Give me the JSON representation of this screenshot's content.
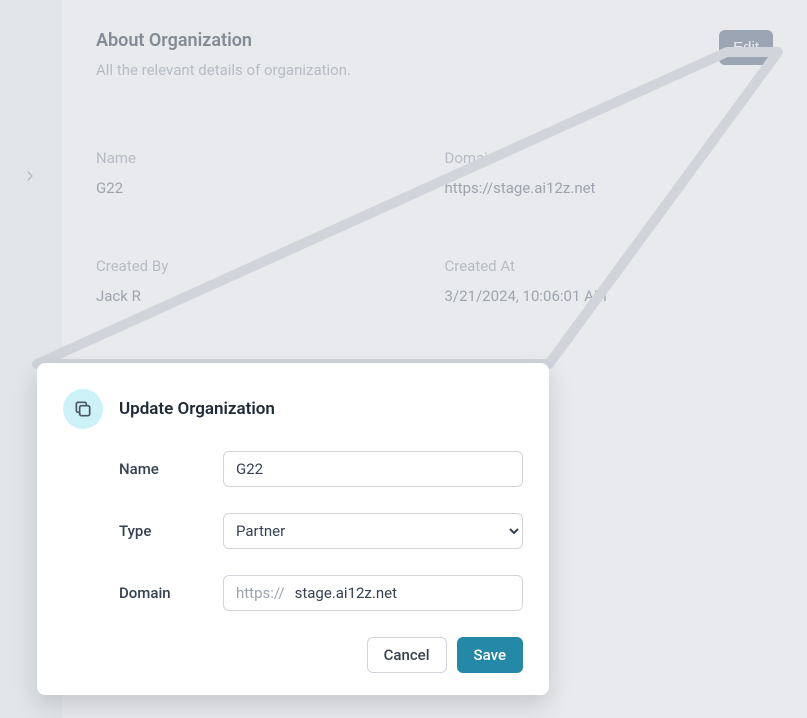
{
  "about": {
    "title": "About Organization",
    "subtitle": "All the relevant details of organization.",
    "edit_label": "Edit",
    "fields": {
      "name_label": "Name",
      "name_value": "G22",
      "domain_label": "Domain",
      "domain_value": "https://stage.ai12z.net",
      "created_by_label": "Created By",
      "created_by_value": "Jack R",
      "created_at_label": "Created At",
      "created_at_value": "3/21/2024, 10:06:01 AM"
    }
  },
  "modal": {
    "title": "Update Organization",
    "name_label": "Name",
    "name_value": "G22",
    "type_label": "Type",
    "type_value": "Partner",
    "type_options": [
      "Partner"
    ],
    "domain_label": "Domain",
    "domain_prefix": "https://",
    "domain_value": "stage.ai12z.net",
    "cancel_label": "Cancel",
    "save_label": "Save"
  }
}
